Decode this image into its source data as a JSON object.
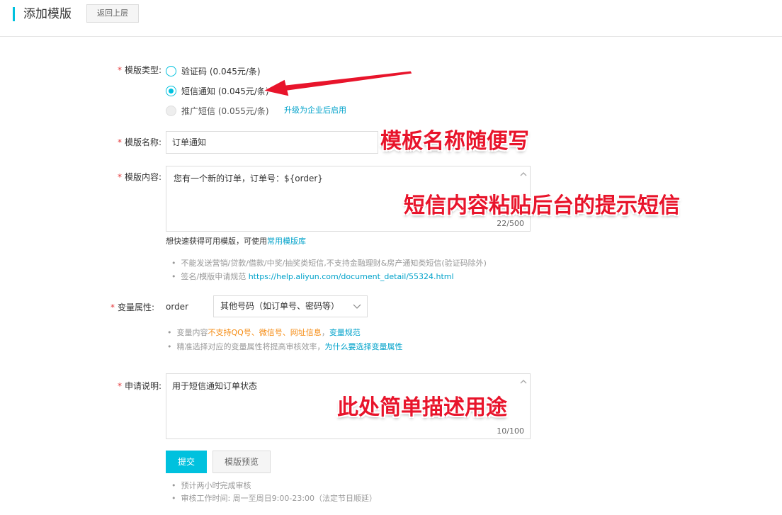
{
  "header": {
    "title": "添加模版",
    "back_label": "返回上层"
  },
  "form": {
    "type": {
      "label": "模版类型:",
      "options": [
        {
          "label": "验证码 (0.045元/条)",
          "state": "unchecked"
        },
        {
          "label": "短信通知 (0.045元/条)",
          "state": "checked"
        },
        {
          "label": "推广短信 (0.055元/条)",
          "state": "disabled"
        }
      ],
      "upgrade_link": "升级为企业后启用"
    },
    "name": {
      "label": "模版名称:",
      "value": "订单通知"
    },
    "content": {
      "label": "模版内容:",
      "value": "您有一个新的订单，订单号：${order}",
      "counter": "22/500",
      "quick_prefix": "想快速获得可用模版，可使用",
      "quick_link": "常用模版库",
      "rules": [
        "不能发送营销/贷款/借款/中奖/抽奖类短信,不支持金融理财&房产通知类短信(验证码除外)",
        "签名/模版申请规范"
      ],
      "rule_link": "https://help.aliyun.com/document_detail/55324.html"
    },
    "variable": {
      "label": "变量属性:",
      "name": "order",
      "select_value": "其他号码（如订单号、密码等）",
      "hint1_prefix": "变量内容",
      "hint1_orange": "不支持QQ号、微信号、网址信息",
      "hint1_sep": "，",
      "hint1_link": "变量规范",
      "hint2_text": "精准选择对应的变量属性将提高审核效率，",
      "hint2_link": "为什么要选择变量属性"
    },
    "description": {
      "label": "申请说明:",
      "value": "用于短信通知订单状态",
      "counter": "10/100"
    },
    "submit_label": "提交",
    "preview_label": "模版预览",
    "footer_notes": [
      "预计两小时完成审核",
      "审核工作时间: 周一至周日9:00-23:00（法定节日顺延）"
    ]
  },
  "annotations": {
    "name_note": "模板名称随便写",
    "content_note": "短信内容粘贴后台的提示短信",
    "desc_note": "此处简单描述用途"
  },
  "colors": {
    "accent": "#00c1de",
    "link": "#00a2ca",
    "required": "#e4393c",
    "warning": "#f58a10",
    "annotation": "#e8142b"
  }
}
